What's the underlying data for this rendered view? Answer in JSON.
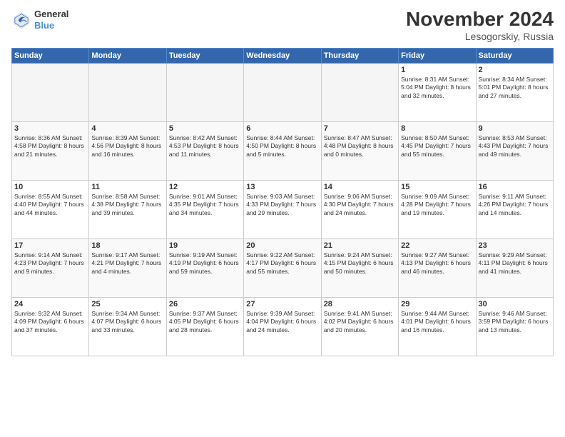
{
  "logo": {
    "line1": "General",
    "line2": "Blue"
  },
  "title": "November 2024",
  "subtitle": "Lesogorskiy, Russia",
  "days_header": [
    "Sunday",
    "Monday",
    "Tuesday",
    "Wednesday",
    "Thursday",
    "Friday",
    "Saturday"
  ],
  "weeks": [
    [
      {
        "day": "",
        "info": ""
      },
      {
        "day": "",
        "info": ""
      },
      {
        "day": "",
        "info": ""
      },
      {
        "day": "",
        "info": ""
      },
      {
        "day": "",
        "info": ""
      },
      {
        "day": "1",
        "info": "Sunrise: 8:31 AM\nSunset: 5:04 PM\nDaylight: 8 hours\nand 32 minutes."
      },
      {
        "day": "2",
        "info": "Sunrise: 8:34 AM\nSunset: 5:01 PM\nDaylight: 8 hours\nand 27 minutes."
      }
    ],
    [
      {
        "day": "3",
        "info": "Sunrise: 8:36 AM\nSunset: 4:58 PM\nDaylight: 8 hours\nand 21 minutes."
      },
      {
        "day": "4",
        "info": "Sunrise: 8:39 AM\nSunset: 4:56 PM\nDaylight: 8 hours\nand 16 minutes."
      },
      {
        "day": "5",
        "info": "Sunrise: 8:42 AM\nSunset: 4:53 PM\nDaylight: 8 hours\nand 11 minutes."
      },
      {
        "day": "6",
        "info": "Sunrise: 8:44 AM\nSunset: 4:50 PM\nDaylight: 8 hours\nand 5 minutes."
      },
      {
        "day": "7",
        "info": "Sunrise: 8:47 AM\nSunset: 4:48 PM\nDaylight: 8 hours\nand 0 minutes."
      },
      {
        "day": "8",
        "info": "Sunrise: 8:50 AM\nSunset: 4:45 PM\nDaylight: 7 hours\nand 55 minutes."
      },
      {
        "day": "9",
        "info": "Sunrise: 8:53 AM\nSunset: 4:43 PM\nDaylight: 7 hours\nand 49 minutes."
      }
    ],
    [
      {
        "day": "10",
        "info": "Sunrise: 8:55 AM\nSunset: 4:40 PM\nDaylight: 7 hours\nand 44 minutes."
      },
      {
        "day": "11",
        "info": "Sunrise: 8:58 AM\nSunset: 4:38 PM\nDaylight: 7 hours\nand 39 minutes."
      },
      {
        "day": "12",
        "info": "Sunrise: 9:01 AM\nSunset: 4:35 PM\nDaylight: 7 hours\nand 34 minutes."
      },
      {
        "day": "13",
        "info": "Sunrise: 9:03 AM\nSunset: 4:33 PM\nDaylight: 7 hours\nand 29 minutes."
      },
      {
        "day": "14",
        "info": "Sunrise: 9:06 AM\nSunset: 4:30 PM\nDaylight: 7 hours\nand 24 minutes."
      },
      {
        "day": "15",
        "info": "Sunrise: 9:09 AM\nSunset: 4:28 PM\nDaylight: 7 hours\nand 19 minutes."
      },
      {
        "day": "16",
        "info": "Sunrise: 9:11 AM\nSunset: 4:26 PM\nDaylight: 7 hours\nand 14 minutes."
      }
    ],
    [
      {
        "day": "17",
        "info": "Sunrise: 9:14 AM\nSunset: 4:23 PM\nDaylight: 7 hours\nand 9 minutes."
      },
      {
        "day": "18",
        "info": "Sunrise: 9:17 AM\nSunset: 4:21 PM\nDaylight: 7 hours\nand 4 minutes."
      },
      {
        "day": "19",
        "info": "Sunrise: 9:19 AM\nSunset: 4:19 PM\nDaylight: 6 hours\nand 59 minutes."
      },
      {
        "day": "20",
        "info": "Sunrise: 9:22 AM\nSunset: 4:17 PM\nDaylight: 6 hours\nand 55 minutes."
      },
      {
        "day": "21",
        "info": "Sunrise: 9:24 AM\nSunset: 4:15 PM\nDaylight: 6 hours\nand 50 minutes."
      },
      {
        "day": "22",
        "info": "Sunrise: 9:27 AM\nSunset: 4:13 PM\nDaylight: 6 hours\nand 46 minutes."
      },
      {
        "day": "23",
        "info": "Sunrise: 9:29 AM\nSunset: 4:11 PM\nDaylight: 6 hours\nand 41 minutes."
      }
    ],
    [
      {
        "day": "24",
        "info": "Sunrise: 9:32 AM\nSunset: 4:09 PM\nDaylight: 6 hours\nand 37 minutes."
      },
      {
        "day": "25",
        "info": "Sunrise: 9:34 AM\nSunset: 4:07 PM\nDaylight: 6 hours\nand 33 minutes."
      },
      {
        "day": "26",
        "info": "Sunrise: 9:37 AM\nSunset: 4:05 PM\nDaylight: 6 hours\nand 28 minutes."
      },
      {
        "day": "27",
        "info": "Sunrise: 9:39 AM\nSunset: 4:04 PM\nDaylight: 6 hours\nand 24 minutes."
      },
      {
        "day": "28",
        "info": "Sunrise: 9:41 AM\nSunset: 4:02 PM\nDaylight: 6 hours\nand 20 minutes."
      },
      {
        "day": "29",
        "info": "Sunrise: 9:44 AM\nSunset: 4:01 PM\nDaylight: 6 hours\nand 16 minutes."
      },
      {
        "day": "30",
        "info": "Sunrise: 9:46 AM\nSunset: 3:59 PM\nDaylight: 6 hours\nand 13 minutes."
      }
    ]
  ]
}
